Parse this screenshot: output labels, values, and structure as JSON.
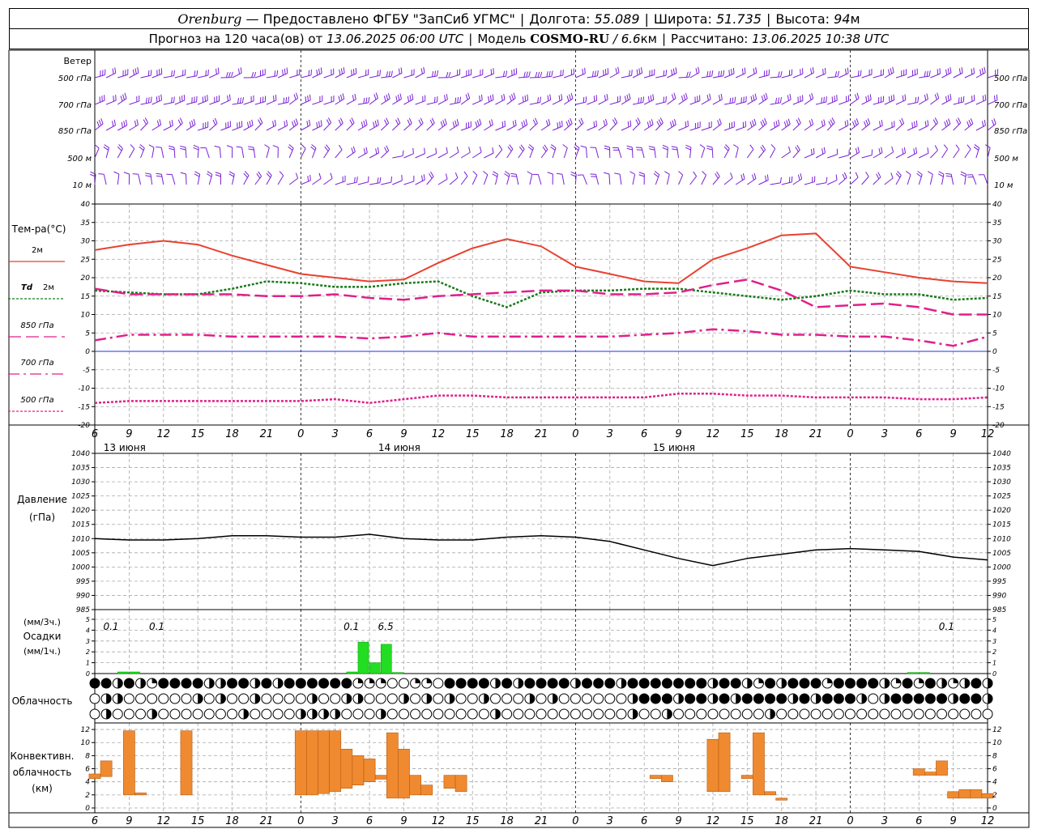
{
  "header": {
    "city": "Orenburg",
    "provider": "— Предоставлено ФГБУ \"ЗапСиб УГМС\"",
    "lon_label": "Долгота:",
    "lon_value": "55.089",
    "lat_label": "Широта:",
    "lat_value": "51.735",
    "alt_label": "Высота:",
    "alt_value": "94",
    "alt_unit": "м",
    "forecast_prefix": "Прогноз на 120 часа(ов) от",
    "forecast_start": "13.06.2025 06:00 UTC",
    "model_label": "Модель",
    "model_name": "COSMO-RU",
    "model_res": "/ 6.6",
    "model_res_unit": "км",
    "computed_label": "Рассчитано:",
    "computed_time": "13.06.2025 10:38 UTC"
  },
  "colors": {
    "wind": "#7a1fd6",
    "t2m": "#e8412f",
    "td2m": "#1a7a1a",
    "t850": "#e0208a",
    "t700": "#e0208a",
    "t500": "#e0208a",
    "zero": "#2030e0",
    "pressure": "#000000",
    "precip": "#22dd22",
    "conv": "#f08a30",
    "grid": "#a8a8a8"
  },
  "time_axis": {
    "hours": [
      6,
      9,
      12,
      15,
      18,
      21,
      0,
      3,
      6,
      9,
      12,
      15,
      18,
      21,
      0,
      3,
      6,
      9,
      12,
      15,
      18,
      21,
      0,
      3,
      6,
      9,
      12
    ],
    "days": [
      "13 июня",
      "14 июня",
      "15 июня"
    ]
  },
  "wind_panel": {
    "title": "Ветер",
    "levels": [
      "500 гПа",
      "700 гПа",
      "850 гПа",
      "500 м",
      "10 м"
    ]
  },
  "temp_panel": {
    "title": "Тем-ра(°C)",
    "legend": [
      {
        "label": "2м",
        "style": "solid"
      },
      {
        "label": "Td",
        "label_suffix": "2м",
        "style": "dotted"
      },
      {
        "label": "850 гПа",
        "style": "dashed"
      },
      {
        "label": "700 гПа",
        "style": "dashdot"
      },
      {
        "label": "500 гПа",
        "style": "dotted"
      }
    ]
  },
  "pressure_panel": {
    "title": "Давление",
    "unit": "(гПа)"
  },
  "precip_panel": {
    "unit_top": "(мм/3ч.)",
    "title": "Осадки",
    "unit_bottom": "(мм/1ч.)"
  },
  "cloud_panel": {
    "title": "Облачность"
  },
  "conv_panel": {
    "title_1": "Конвективн.",
    "title_2": "облачность",
    "title_3": "(км)"
  },
  "chart_data": [
    {
      "type": "line",
      "title": "Тем-ра(°C)",
      "ylim": [
        -20,
        40
      ],
      "yticks": [
        -20,
        -15,
        -10,
        -5,
        0,
        5,
        10,
        15,
        20,
        25,
        30,
        35,
        40
      ],
      "x_hours_from_start": [
        0,
        3,
        6,
        9,
        12,
        15,
        18,
        21,
        24,
        27,
        30,
        33,
        36,
        39,
        42,
        45,
        48,
        51,
        54,
        57,
        60,
        63,
        66,
        69,
        72,
        75,
        78
      ],
      "series": [
        {
          "name": "2м",
          "values": [
            27.5,
            29,
            30,
            29,
            26,
            23.5,
            21,
            20,
            19,
            19.5,
            24,
            28,
            30.5,
            28.5,
            23,
            21,
            19,
            18.5,
            25,
            28,
            31.5,
            32,
            23,
            21.5,
            20,
            19,
            18.5
          ]
        },
        {
          "name": "Td 2м",
          "values": [
            16.5,
            16,
            15.5,
            15.5,
            17,
            19,
            18.5,
            17.5,
            17.5,
            18.5,
            19,
            15,
            12,
            16,
            16.5,
            16.5,
            17,
            17,
            16,
            15,
            14,
            15,
            16.5,
            15.5,
            15.5,
            14,
            14.5
          ]
        },
        {
          "name": "850 гПа",
          "values": [
            17,
            15.5,
            15.5,
            15.5,
            15.5,
            15,
            15,
            15.5,
            14.5,
            14,
            15,
            15.5,
            16,
            16.5,
            16.5,
            15.5,
            15.5,
            16,
            18,
            19.5,
            16.5,
            12,
            12.5,
            13,
            12,
            10,
            10
          ]
        },
        {
          "name": "700 гПа",
          "values": [
            3,
            4.5,
            4.5,
            4.5,
            4,
            4,
            4,
            4,
            3.5,
            4,
            5,
            4,
            4,
            4,
            4,
            4,
            4.5,
            5,
            6,
            5.5,
            4.5,
            4.5,
            4,
            4,
            3,
            1.5,
            4
          ]
        },
        {
          "name": "500 гПа",
          "values": [
            -14,
            -13.5,
            -13.5,
            -13.5,
            -13.5,
            -13.5,
            -13.5,
            -13,
            -14,
            -13,
            -12,
            -12,
            -12.5,
            -12.5,
            -12.5,
            -12.5,
            -12.5,
            -11.5,
            -11.5,
            -12,
            -12,
            -12.5,
            -12.5,
            -12.5,
            -13,
            -13,
            -12.5
          ]
        }
      ]
    },
    {
      "type": "line",
      "title": "Давление",
      "ylabel": "(гПа)",
      "ylim": [
        985,
        1040
      ],
      "yticks": [
        985,
        990,
        995,
        1000,
        1005,
        1010,
        1015,
        1020,
        1025,
        1030,
        1035,
        1040
      ],
      "x_hours_from_start": [
        0,
        3,
        6,
        9,
        12,
        15,
        18,
        21,
        24,
        27,
        30,
        33,
        36,
        39,
        42,
        45,
        48,
        51,
        54,
        57,
        60,
        63,
        66,
        69,
        72,
        75,
        78
      ],
      "series": [
        {
          "name": "",
          "values": [
            1010,
            1009.5,
            1009.5,
            1010,
            1011,
            1011,
            1010.5,
            1010.5,
            1011.5,
            1010,
            1009.5,
            1009.5,
            1010.5,
            1011,
            1010.5,
            1009,
            1006,
            1003,
            1000.5,
            1003,
            1004.5,
            1006,
            1006.5,
            1006,
            1005.5,
            1003.5,
            1002.5
          ]
        }
      ]
    },
    {
      "type": "bar",
      "title": "Осадки",
      "ylim": [
        0,
        5
      ],
      "yticks": [
        0,
        1,
        2,
        3,
        4,
        5
      ],
      "labels_3h": [
        {
          "hour": 0,
          "text": "0.1"
        },
        {
          "hour": 4,
          "text": "0.1"
        },
        {
          "hour": 21,
          "text": "0.1"
        },
        {
          "hour": 24,
          "text": "6.5"
        },
        {
          "hour": 73,
          "text": "0.1"
        }
      ],
      "bars_1h": [
        {
          "hour": 3,
          "value": 0.15
        },
        {
          "hour": 4,
          "value": 0.15
        },
        {
          "hour": 23,
          "value": 0.15
        },
        {
          "hour": 24,
          "value": 2.9
        },
        {
          "hour": 25,
          "value": 1.0
        },
        {
          "hour": 26,
          "value": 2.7
        },
        {
          "hour": 27,
          "value": 0.1
        },
        {
          "hour": 72,
          "value": 0.1
        },
        {
          "hour": 73,
          "value": 0.1
        }
      ]
    },
    {
      "type": "bar",
      "title": "Конвективн. облачность (км)",
      "ylim": [
        0,
        13
      ],
      "yticks": [
        0,
        2,
        4,
        6,
        8,
        10,
        12
      ],
      "floating_bars": [
        {
          "hour": 0,
          "base": 4.5,
          "top": 5.2
        },
        {
          "hour": 1,
          "base": 4.8,
          "top": 7.2
        },
        {
          "hour": 3,
          "base": 2,
          "top": 11.8
        },
        {
          "hour": 4,
          "base": 2,
          "top": 2.3
        },
        {
          "hour": 8,
          "base": 2,
          "top": 11.8
        },
        {
          "hour": 18,
          "base": 2,
          "top": 11.8
        },
        {
          "hour": 19,
          "base": 2,
          "top": 11.8
        },
        {
          "hour": 20,
          "base": 2.2,
          "top": 11.8
        },
        {
          "hour": 21,
          "base": 2.5,
          "top": 11.8
        },
        {
          "hour": 22,
          "base": 3,
          "top": 9
        },
        {
          "hour": 23,
          "base": 3.5,
          "top": 8
        },
        {
          "hour": 24,
          "base": 4,
          "top": 7.5
        },
        {
          "hour": 25,
          "base": 4.4,
          "top": 5
        },
        {
          "hour": 26,
          "base": 1.5,
          "top": 11.5
        },
        {
          "hour": 27,
          "base": 1.5,
          "top": 9
        },
        {
          "hour": 28,
          "base": 2,
          "top": 5
        },
        {
          "hour": 29,
          "base": 2,
          "top": 3.5
        },
        {
          "hour": 31,
          "base": 3,
          "top": 5
        },
        {
          "hour": 32,
          "base": 2.5,
          "top": 5
        },
        {
          "hour": 49,
          "base": 4.5,
          "top": 5
        },
        {
          "hour": 50,
          "base": 4,
          "top": 5
        },
        {
          "hour": 54,
          "base": 2.5,
          "top": 10.5
        },
        {
          "hour": 55,
          "base": 2.5,
          "top": 11.5
        },
        {
          "hour": 57,
          "base": 4.5,
          "top": 5
        },
        {
          "hour": 58,
          "base": 2,
          "top": 11.5
        },
        {
          "hour": 59,
          "base": 2,
          "top": 2.5
        },
        {
          "hour": 60,
          "base": 1.2,
          "top": 1.5
        },
        {
          "hour": 72,
          "base": 5,
          "top": 6
        },
        {
          "hour": 73,
          "base": 5,
          "top": 5.5
        },
        {
          "hour": 74,
          "base": 5,
          "top": 7.2
        },
        {
          "hour": 75,
          "base": 1.5,
          "top": 2.5
        },
        {
          "hour": 76,
          "base": 1.5,
          "top": 2.8
        },
        {
          "hour": 77,
          "base": 1.5,
          "top": 2.8
        },
        {
          "hour": 78,
          "base": 1.5,
          "top": 2.2
        }
      ]
    }
  ]
}
